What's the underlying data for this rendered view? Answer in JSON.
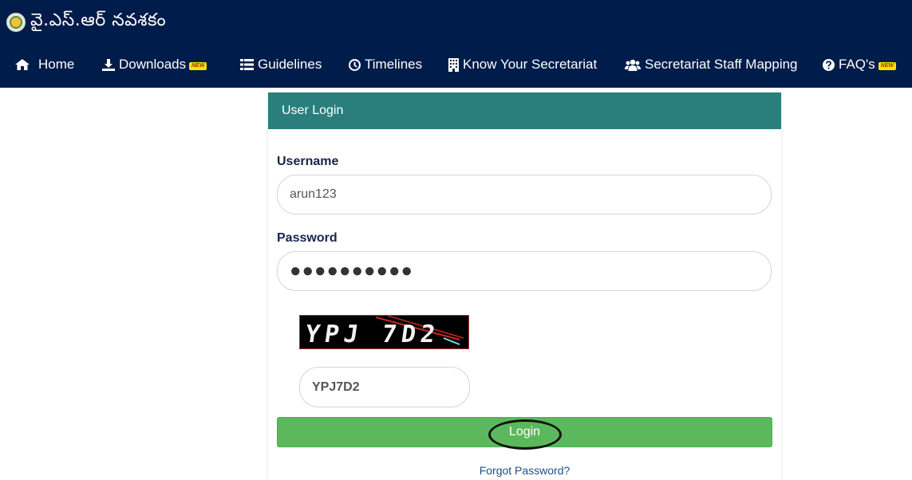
{
  "header": {
    "title": "వై.ఎస్.ఆర్ నవశకం",
    "logo_icon": "emblem-icon"
  },
  "nav": {
    "items": [
      {
        "label": "Home",
        "icon": "home-icon",
        "new": false
      },
      {
        "label": "Downloads",
        "icon": "download-icon",
        "new": true
      },
      {
        "label": "Guidelines",
        "icon": "list-icon",
        "new": false
      },
      {
        "label": "Timelines",
        "icon": "clock-icon",
        "new": false
      },
      {
        "label": "Know Your Secretariat",
        "icon": "building-icon",
        "new": false
      },
      {
        "label": "Secretariat Staff Mapping",
        "icon": "users-icon",
        "new": false
      },
      {
        "label": "FAQ's",
        "icon": "question-icon",
        "new": true
      }
    ],
    "new_badge": "NEW"
  },
  "login": {
    "header": "User Login",
    "username_label": "Username",
    "username_value": "arun123",
    "password_label": "Password",
    "password_value": "●●●●●●●●●●",
    "captcha_image_text": "YPJ 7D2",
    "captcha_value": "YPJ7D2",
    "login_button": "Login",
    "forgot_link": "Forgot Password?"
  },
  "colors": {
    "topbar": "#001c4a",
    "card_header": "#2a7f7d",
    "login_button": "#5cb85c",
    "link": "#1f4e8a"
  }
}
